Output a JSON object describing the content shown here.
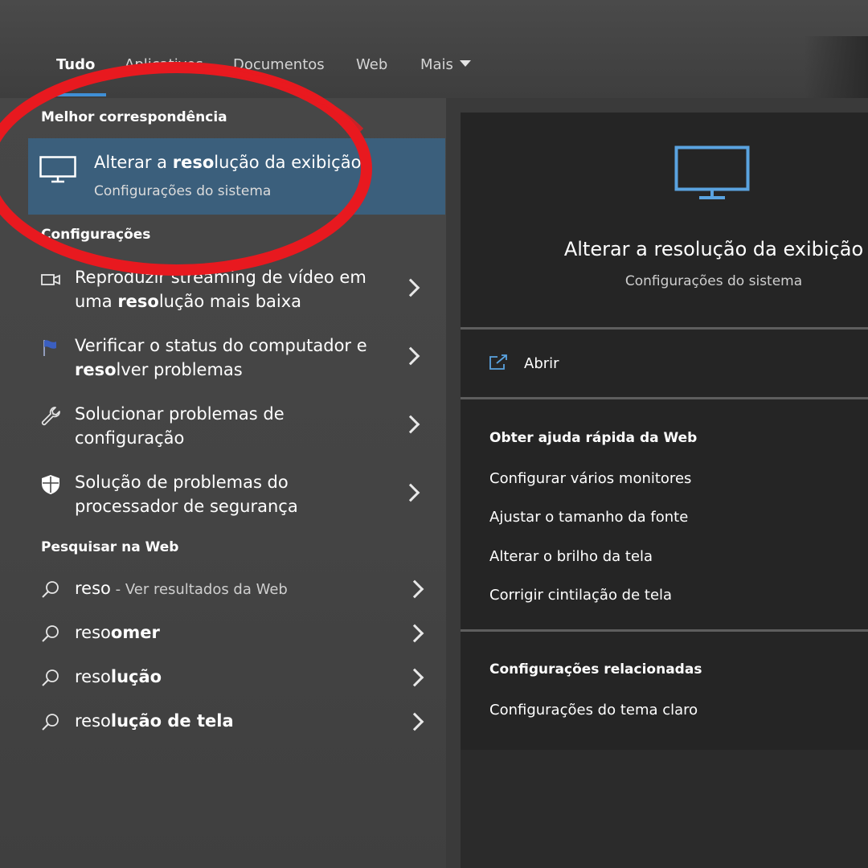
{
  "tabs": [
    {
      "label": "Tudo",
      "active": true
    },
    {
      "label": "Aplicativos",
      "active": false
    },
    {
      "label": "Documentos",
      "active": false
    },
    {
      "label": "Web",
      "active": false
    },
    {
      "label": "Mais",
      "active": false
    }
  ],
  "best_match": {
    "section_title": "Melhor correspondência",
    "title_pre": "Alterar a ",
    "title_bold": "reso",
    "title_post": "lução da exibição",
    "subtitle": "Configurações do sistema",
    "icon": "monitor-icon"
  },
  "settings": {
    "section_title": "Configurações",
    "items": [
      {
        "pre": "Reproduzir streaming de vídeo em uma ",
        "bold": "reso",
        "post": "lução mais baixa",
        "icon": "video-icon"
      },
      {
        "pre": "Verificar o status do computador e ",
        "bold": "reso",
        "post": "lver problemas",
        "icon": "flag-icon"
      },
      {
        "pre": "Solucionar problemas de configuração",
        "bold": "",
        "post": "",
        "icon": "wrench-icon"
      },
      {
        "pre": "Solução de problemas do processador de segurança",
        "bold": "",
        "post": "",
        "icon": "shield-icon"
      }
    ]
  },
  "web_search": {
    "section_title": "Pesquisar na Web",
    "items": [
      {
        "plain": "reso",
        "bold": "",
        "suffix": " - Ver resultados da Web"
      },
      {
        "plain": "reso",
        "bold": "omer",
        "suffix": ""
      },
      {
        "plain": "reso",
        "bold": "lução",
        "suffix": ""
      },
      {
        "plain": "reso",
        "bold": "lução de tela",
        "suffix": ""
      }
    ]
  },
  "detail": {
    "title": "Alterar a resolução da exibição",
    "subtitle": "Configurações do sistema",
    "open_label": "Abrir",
    "help_heading": "Obter ajuda rápida da Web",
    "help_links": [
      "Configurar vários monitores",
      "Ajustar o tamanho da fonte",
      "Alterar o brilho da tela",
      "Corrigir cintilação de tela"
    ],
    "related_heading": "Configurações relacionadas",
    "related_links": [
      "Configurações do tema claro"
    ]
  },
  "colors": {
    "accent": "#3f8fd6",
    "selected_bg": "#3b5f7c",
    "annotation": "#e8191f",
    "monitor_icon_large": "#5aa3e0"
  }
}
